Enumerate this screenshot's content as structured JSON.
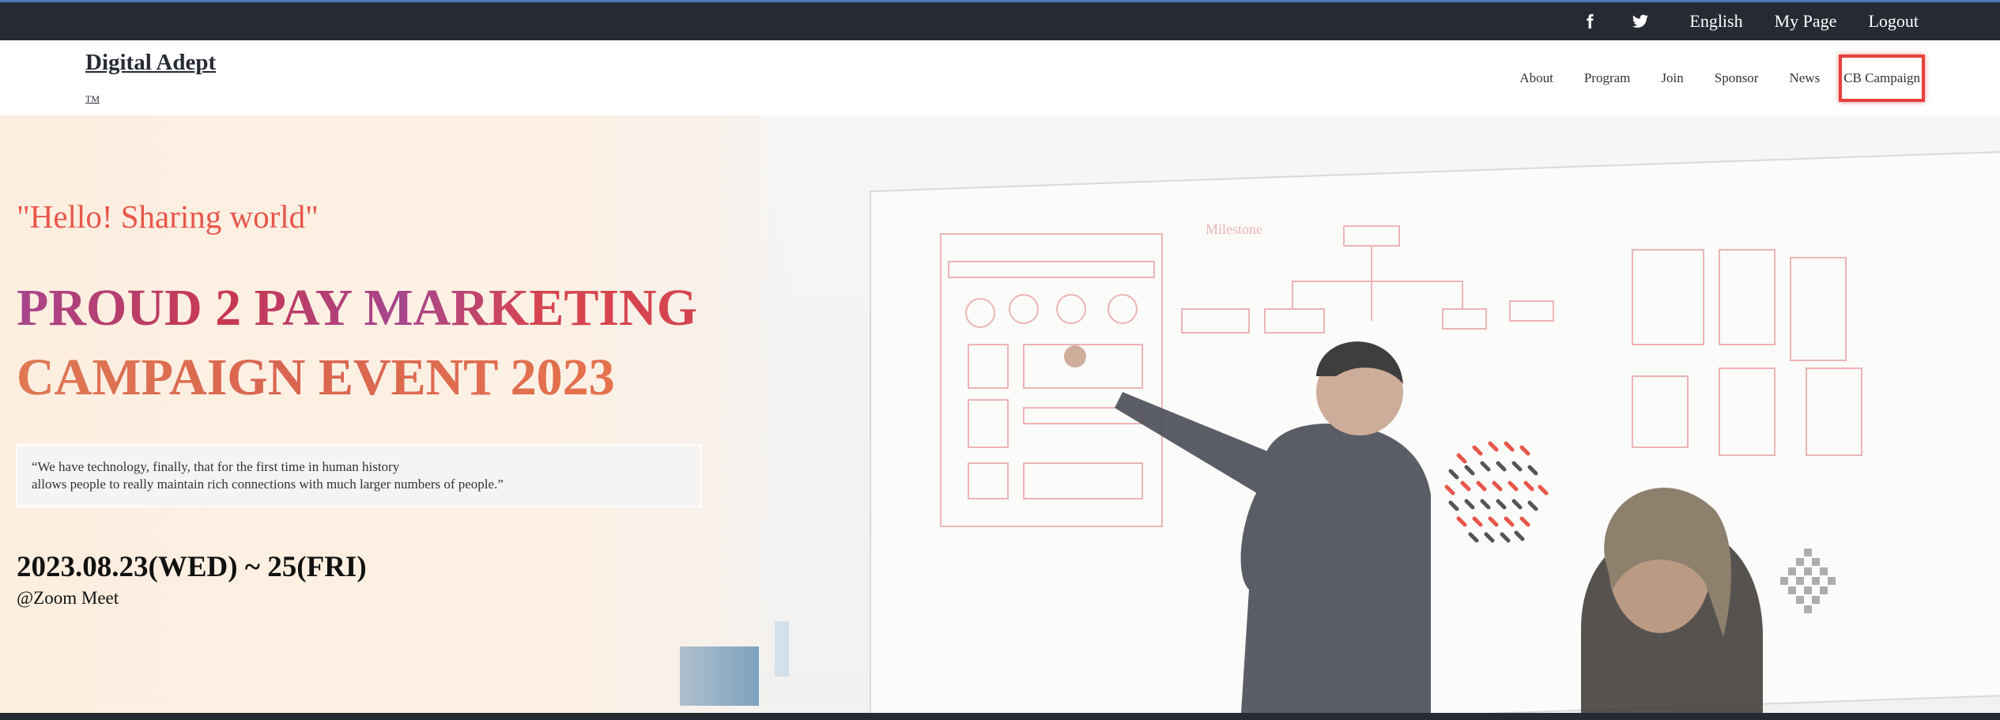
{
  "topbar": {
    "icons": [
      "facebook-icon",
      "twitter-icon"
    ],
    "links": [
      "English",
      "My Page",
      "Logout"
    ]
  },
  "header": {
    "brand": "Digital Adept",
    "tm": "TM",
    "nav": [
      "About",
      "Program",
      "Join",
      "Sponsor",
      "News",
      "CB Campaign"
    ]
  },
  "hero": {
    "tagline": "\"Hello! Sharing world\"",
    "title_line1": "PROUD 2 PAY MARKETING",
    "title_line2": "CAMPAIGN EVENT 2023",
    "quote_line1": "“We have technology, finally, that for the first time in human history",
    "quote_line2": "allows people to really maintain rich connections with much larger numbers of people.”",
    "date": "2023.08.23(WED) ~ 25(FRI)",
    "venue": "@Zoom Meet"
  },
  "colors": {
    "topbar": "#262a33",
    "accent": "#e8564a",
    "highlight": "#e8403c"
  }
}
